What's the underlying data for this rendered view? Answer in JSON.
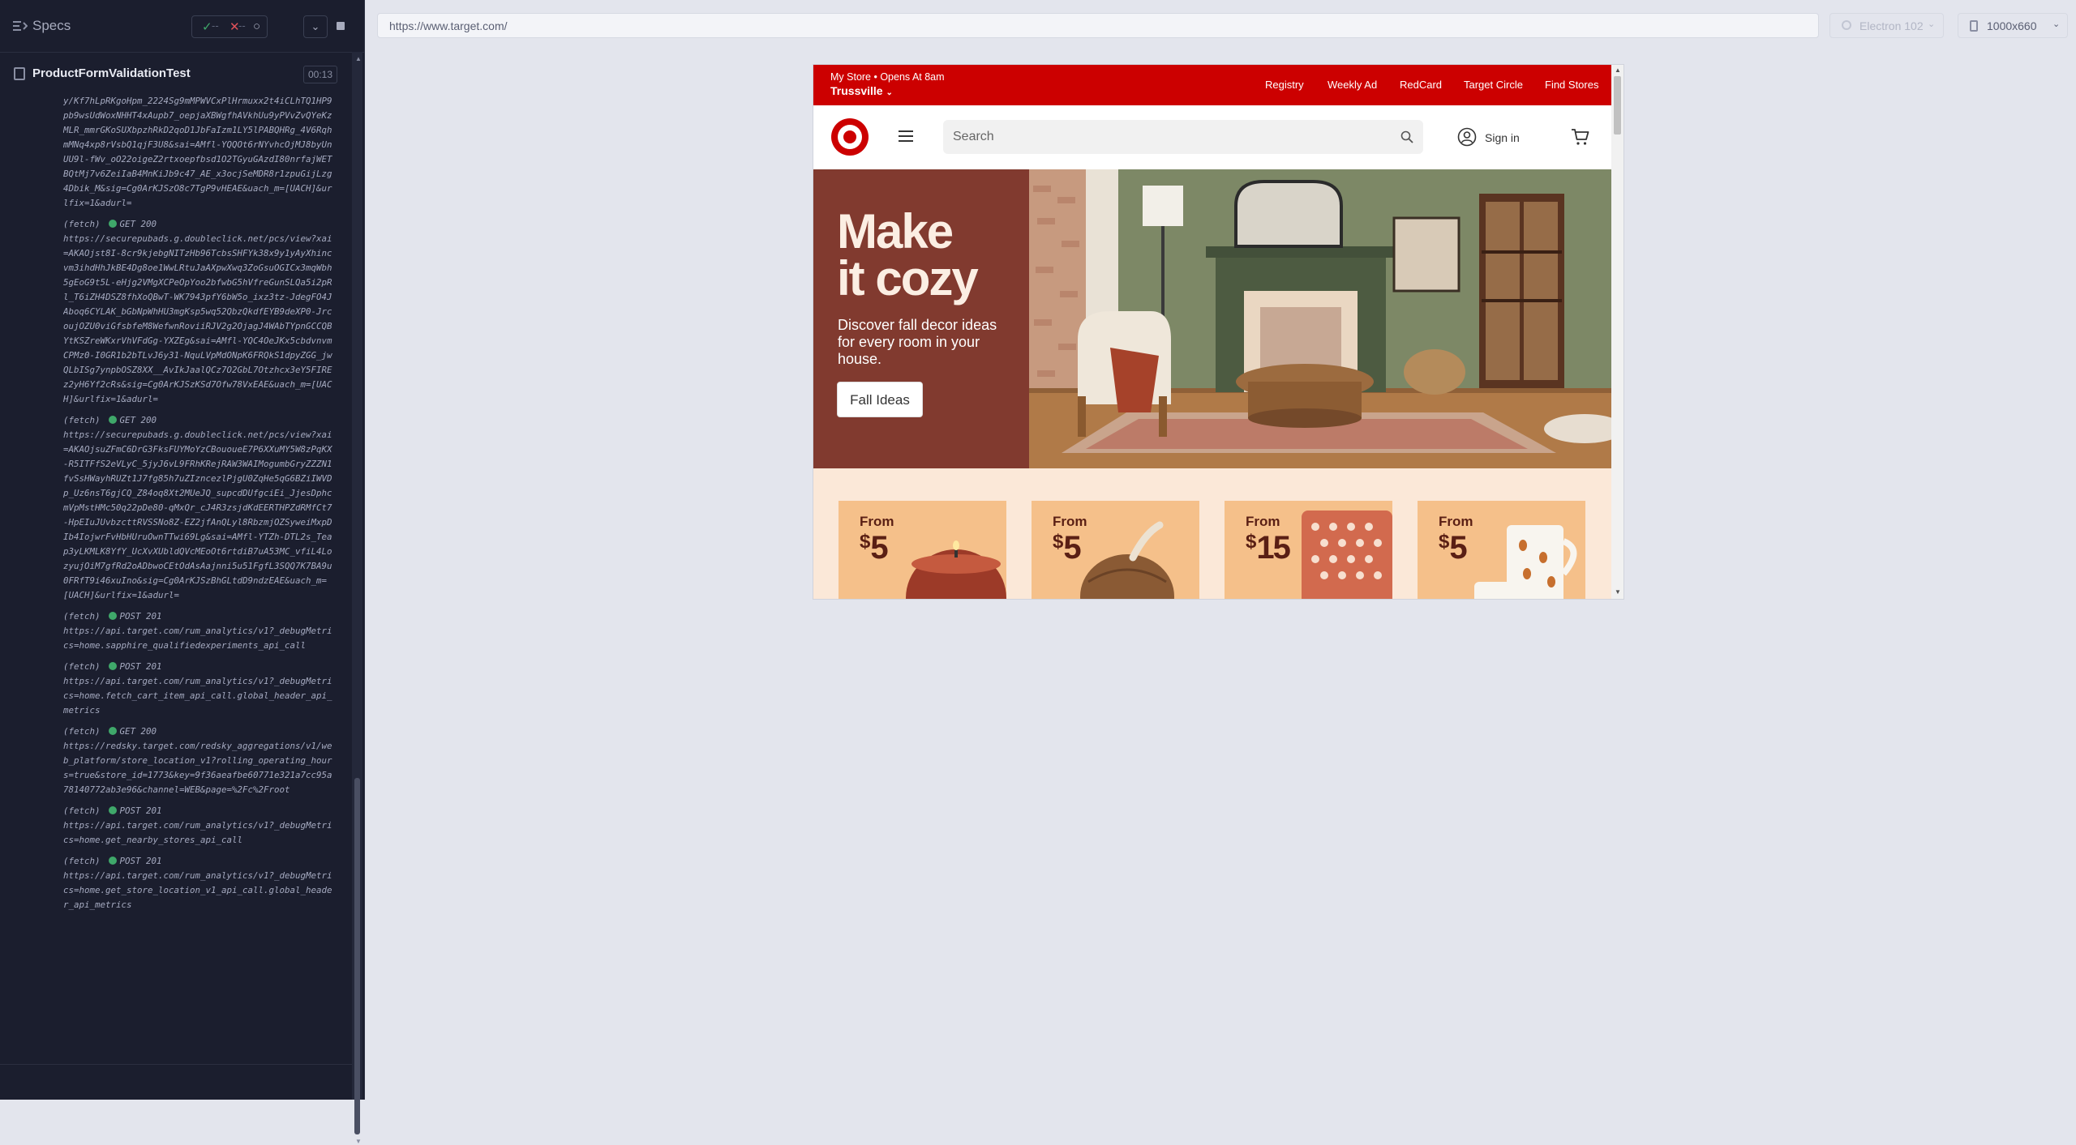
{
  "reporter": {
    "specs_label": "Specs",
    "stats": {
      "passed": "✓",
      "failed": "✕",
      "pending": "○",
      "dash": "--"
    },
    "test_title": "ProductFormValidationTest",
    "duration": "00:13",
    "log": [
      {
        "head": "",
        "text": "y/Kf7hLpRKgoHpm_2224Sg9mMPWVCxPlHrmuxx2t4iCLhTQ1HP9pb9wsUdWoxNHHT4xAupb7_oepjaXBWgfhAVkhUu9yPVvZvQYeKzMLR_mmrGKoSUXbpzhRkD2qoD1JbFaIzm1LY5lPABQHRg_4V6RqhmMNq4xp8rVsbQ1qjF3U8&sai=AMfl-YQQOt6rNYvhcOjMJ8byUnUU9l-fWv_oO22oigeZ2rtxoepfbsd1O2TGyuGAzdI80nrfajWETBQtMj7v6ZeiIaB4MnKiJb9c47_AE_x3ocjSeMDR8r1zpuGijLzg4Dbik_M&sig=Cg0ArKJSzO8c7TgP9vHEAE&uach_m=[UACH]&urlfix=1&adurl="
      },
      {
        "head": "(fetch)",
        "status": "GET 200",
        "text": "https://securepubads.g.doubleclick.net/pcs/view?xai=AKAOjst8I-8cr9kjebgNITzHb96TcbsSHFYk38x9y1yAyXhincvm3ihdHhJkBE4Dg8oe1WwLRtuJaAXpwXwq3ZoGsuOGICx3mqWbh5gEoG9t5L-eHjg2VMgXCPeOpYoo2bfwbG5hVfreGunSLQa5i2pRl_T6iZH4DSZ8fhXoQBwT-WK7943pfY6bW5o_ixz3tz-JdegFO4JAboq6CYLAK_bGbNpWhHU3mgKsp5wq52QbzQkdfEYB9deXP0-JrcoujOZU0viGfsbfeM8WefwnRoviiRJV2g2OjagJ4WAbTYpnGCCQBYtKSZreWKxrVhVFdGg-YXZEg&sai=AMfl-YQC4OeJKx5cbdvnvmCPMz0-I0GR1b2bTLvJ6y31-NquLVpMdONpK6FRQkS1dpyZGG_jwQLbISg7ynpbOSZ8XX__AvIkJaalQCz7O2GbL7Otzhcx3eY5FIREz2yH6Yf2cRs&sig=Cg0ArKJSzKSd7Ofw78VxEAE&uach_m=[UACH]&urlfix=1&adurl="
      },
      {
        "head": "(fetch)",
        "status": "GET 200",
        "text": "https://securepubads.g.doubleclick.net/pcs/view?xai=AKAOjsuZFmC6DrG3FksFUYMoYzCBououeE7P6XXuMY5W8zPqKX-R5ITFfS2eVLyC_5jyJ6vL9FRhKRejRAW3WAIMogumbGryZZZN1fvSsHWayhRUZt1J7fg85h7uZIzncezlPjgU0ZqHe5qG6BZiIWVDp_Uz6nsT6gjCQ_Z84oq8Xt2MUeJQ_supcdDUfgciEi_JjesDphcmVpMstHMc50q22pDe80-qMxQr_cJ4R3zsjdKdEERTHPZdRMfCt7-HpEIuJUvbzcttRVSSNo8Z-EZ2jfAnQLyl8RbzmjOZSyweiMxpDIb4IojwrFvHbHUruOwnTTwi69Lg&sai=AMfl-YTZh-DTL2s_Teap3yLKMLK8YfY_UcXvXUbldQVcMEoOt6rtdiB7uA53MC_vfiL4LozyujOiM7gfRd2oADbwoCEtOdAsAajnni5u51FgfL3SQQ7K7BA9u0FRfT9i46xuIno&sig=Cg0ArKJSzBhGLtdD9ndzEAE&uach_m=[UACH]&urlfix=1&adurl="
      },
      {
        "head": "(fetch)",
        "status": "POST 201",
        "text": "https://api.target.com/rum_analytics/v1?_debugMetrics=home.sapphire_qualifiedexperiments_api_call"
      },
      {
        "head": "(fetch)",
        "status": "POST 201",
        "text": "https://api.target.com/rum_analytics/v1?_debugMetrics=home.fetch_cart_item_api_call.global_header_api_metrics"
      },
      {
        "head": "(fetch)",
        "status": "GET 200",
        "text": "https://redsky.target.com/redsky_aggregations/v1/web_platform/store_location_v1?rolling_operating_hours=true&store_id=1773&key=9f36aeafbe60771e321a7cc95a78140772ab3e96&channel=WEB&page=%2Fc%2Froot"
      },
      {
        "head": "(fetch)",
        "status": "POST 201",
        "text": "https://api.target.com/rum_analytics/v1?_debugMetrics=home.get_nearby_stores_api_call"
      },
      {
        "head": "(fetch)",
        "status": "POST 201",
        "text": "https://api.target.com/rum_analytics/v1?_debugMetrics=home.get_store_location_v1_api_call.global_header_api_metrics"
      }
    ]
  },
  "toolbar": {
    "url": "https://www.target.com/",
    "browser": "Electron 102",
    "viewport": "1000x660"
  },
  "aut": {
    "top_strip": {
      "store_line": "My Store • Opens At 8am",
      "store_name": "Trussville",
      "links": [
        "Registry",
        "Weekly Ad",
        "RedCard",
        "Target Circle",
        "Find Stores"
      ]
    },
    "header": {
      "search_placeholder": "Search",
      "sign_in": "Sign in"
    },
    "hero": {
      "title_line1": "Make",
      "title_line2": "it cozy",
      "subtitle": "Discover fall decor ideas for every room in your house.",
      "button": "Fall Ideas"
    },
    "deals": [
      {
        "from": "From",
        "currency": "$",
        "amount": "5"
      },
      {
        "from": "From",
        "currency": "$",
        "amount": "5"
      },
      {
        "from": "From",
        "currency": "$",
        "amount": "15"
      },
      {
        "from": "From",
        "currency": "$",
        "amount": "5"
      }
    ],
    "colors": {
      "brand_red": "#cc0000",
      "hero_panel": "#813a2f",
      "deal_card": "#f5c08a",
      "deal_band": "#fbe8d8"
    }
  }
}
